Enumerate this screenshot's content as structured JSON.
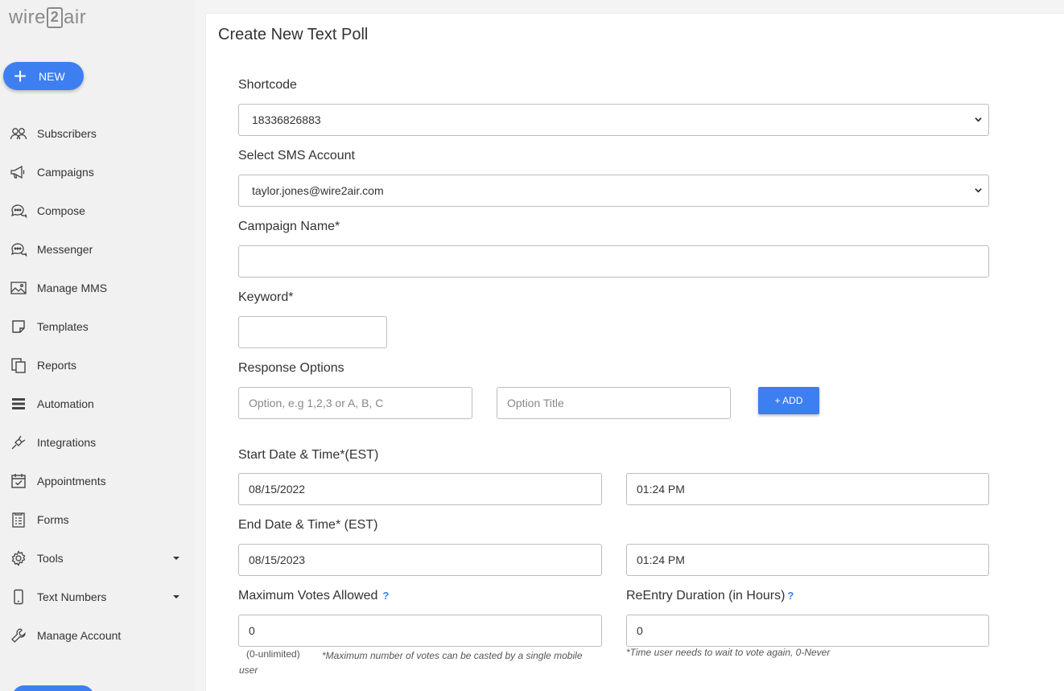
{
  "brand": {
    "logo_left": "wire",
    "logo_mid": "2",
    "logo_right": "air"
  },
  "sidebar": {
    "new_label": "NEW",
    "items": [
      {
        "label": "Subscribers",
        "icon": "users-icon"
      },
      {
        "label": "Campaigns",
        "icon": "megaphone-icon"
      },
      {
        "label": "Compose",
        "icon": "chat-bubbles-icon"
      },
      {
        "label": "Messenger",
        "icon": "messenger-icon"
      },
      {
        "label": "Manage MMS",
        "icon": "image-icon"
      },
      {
        "label": "Templates",
        "icon": "note-icon"
      },
      {
        "label": "Reports",
        "icon": "copy-icon"
      },
      {
        "label": "Automation",
        "icon": "list-icon"
      },
      {
        "label": "Integrations",
        "icon": "plug-icon"
      },
      {
        "label": "Appointments",
        "icon": "calendar-check-icon"
      },
      {
        "label": "Forms",
        "icon": "form-icon"
      },
      {
        "label": "Tools",
        "icon": "gear-icon",
        "has_caret": true
      },
      {
        "label": "Text Numbers",
        "icon": "phone-icon",
        "has_caret": true
      },
      {
        "label": "Manage Account",
        "icon": "wrench-icon"
      }
    ]
  },
  "form": {
    "title": "Create New Text Poll",
    "shortcode_label": "Shortcode",
    "shortcode_value": "18336826883",
    "sms_account_label": "Select SMS Account",
    "sms_account_value": "taylor.jones@wire2air.com",
    "campaign_name_label": "Campaign Name*",
    "campaign_name_value": "",
    "keyword_label": "Keyword*",
    "keyword_value": "",
    "response_options_label": "Response Options",
    "option_placeholder": "Option, e.g 1,2,3 or A, B, C",
    "option_title_placeholder": "Option Title",
    "add_label": "+ ADD",
    "start_label": "Start Date & Time*(EST)",
    "start_date": "08/15/2022",
    "start_time": "01:24 PM",
    "end_label": "End Date & Time* (EST)",
    "end_date": "08/15/2023",
    "end_time": "01:24 PM",
    "max_votes_label": "Maximum Votes Allowed",
    "max_votes_value": "0",
    "max_votes_hint": "(0-unlimited)",
    "max_votes_note": "*Maximum number of votes can be casted by a single mobile user",
    "reentry_label": "ReEntry Duration (in Hours)",
    "reentry_value": "0",
    "reentry_note": "*Time user needs to wait to vote again, 0-Never",
    "help_glyph": "?"
  },
  "colors": {
    "accent": "#3d7ff0",
    "sidebar_bg": "#f1f1f1"
  }
}
